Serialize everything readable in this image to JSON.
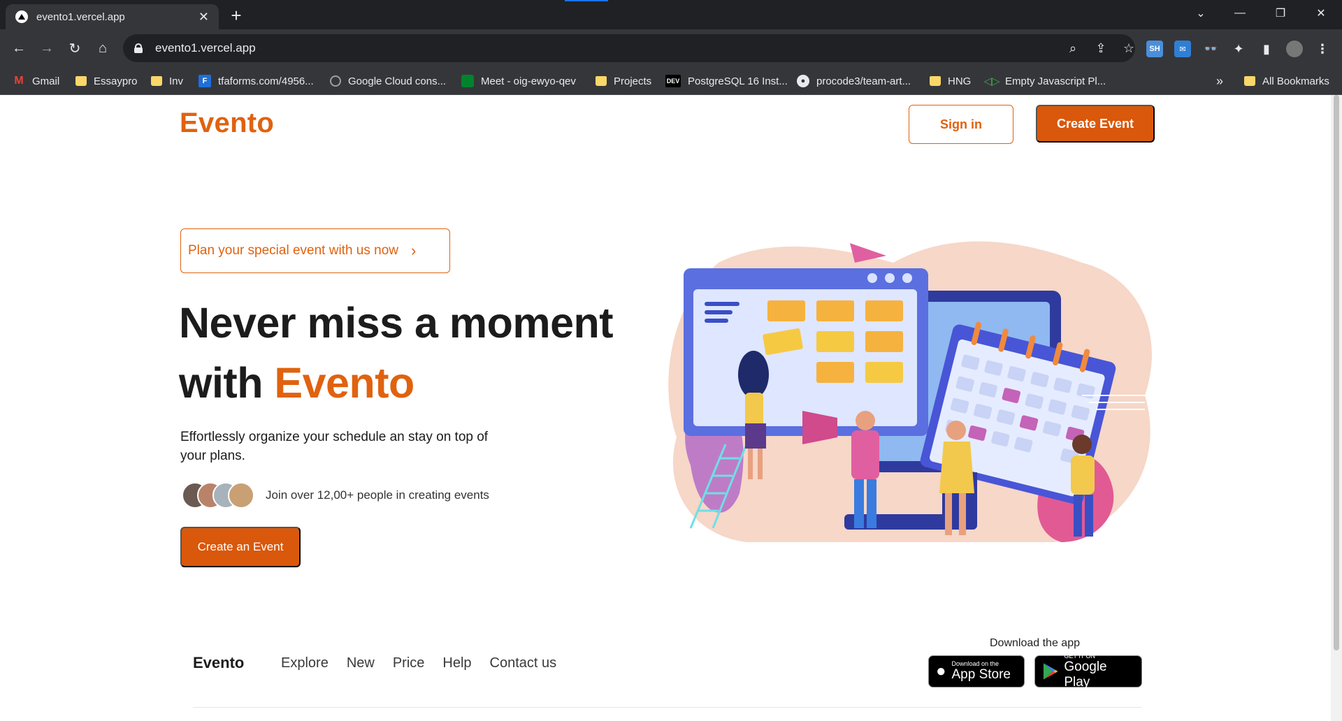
{
  "browser": {
    "tab_title": "evento1.vercel.app",
    "url": "evento1.vercel.app",
    "bookmarks": [
      {
        "label": "Gmail",
        "icon": "gmail-icon"
      },
      {
        "label": "Essaypro",
        "icon": "folder-icon"
      },
      {
        "label": "Inv",
        "icon": "folder-icon"
      },
      {
        "label": "tfaforms.com/4956...",
        "icon": "formassembly-icon"
      },
      {
        "label": "Google Cloud cons...",
        "icon": "google-cloud-icon"
      },
      {
        "label": "Meet - oig-ewyo-qev",
        "icon": "google-meet-icon"
      },
      {
        "label": "Projects",
        "icon": "folder-icon"
      },
      {
        "label": "PostgreSQL 16 Inst...",
        "icon": "dev-icon"
      },
      {
        "label": "procode3/team-art...",
        "icon": "github-icon"
      },
      {
        "label": "HNG",
        "icon": "folder-icon"
      },
      {
        "label": "Empty Javascript Pl...",
        "icon": "code-icon"
      }
    ],
    "all_bookmarks": "All Bookmarks",
    "overflow": "»"
  },
  "header": {
    "logo": "Evento",
    "signin_label": "Sign in",
    "create_label": "Create Event"
  },
  "hero": {
    "pill_label": "Plan your special event with us now",
    "title_line1": "Never miss a moment",
    "title_line2_prefix": "with ",
    "title_line2_accent": "Evento",
    "subtitle": "Effortlessly organize your schedule an stay on top of your plans.",
    "join_text": "Join over 12,00+ people in creating events",
    "cta_label": "Create an Event",
    "accent_color": "#e0620f"
  },
  "footer": {
    "logo": "Evento",
    "links": [
      "Explore",
      "New",
      "Price",
      "Help",
      "Contact us"
    ],
    "download_label": "Download the app",
    "app_store": {
      "small": "Download on the",
      "big": "App Store"
    },
    "google_play": {
      "small": "GET IT ON",
      "big": "Google Play"
    }
  }
}
